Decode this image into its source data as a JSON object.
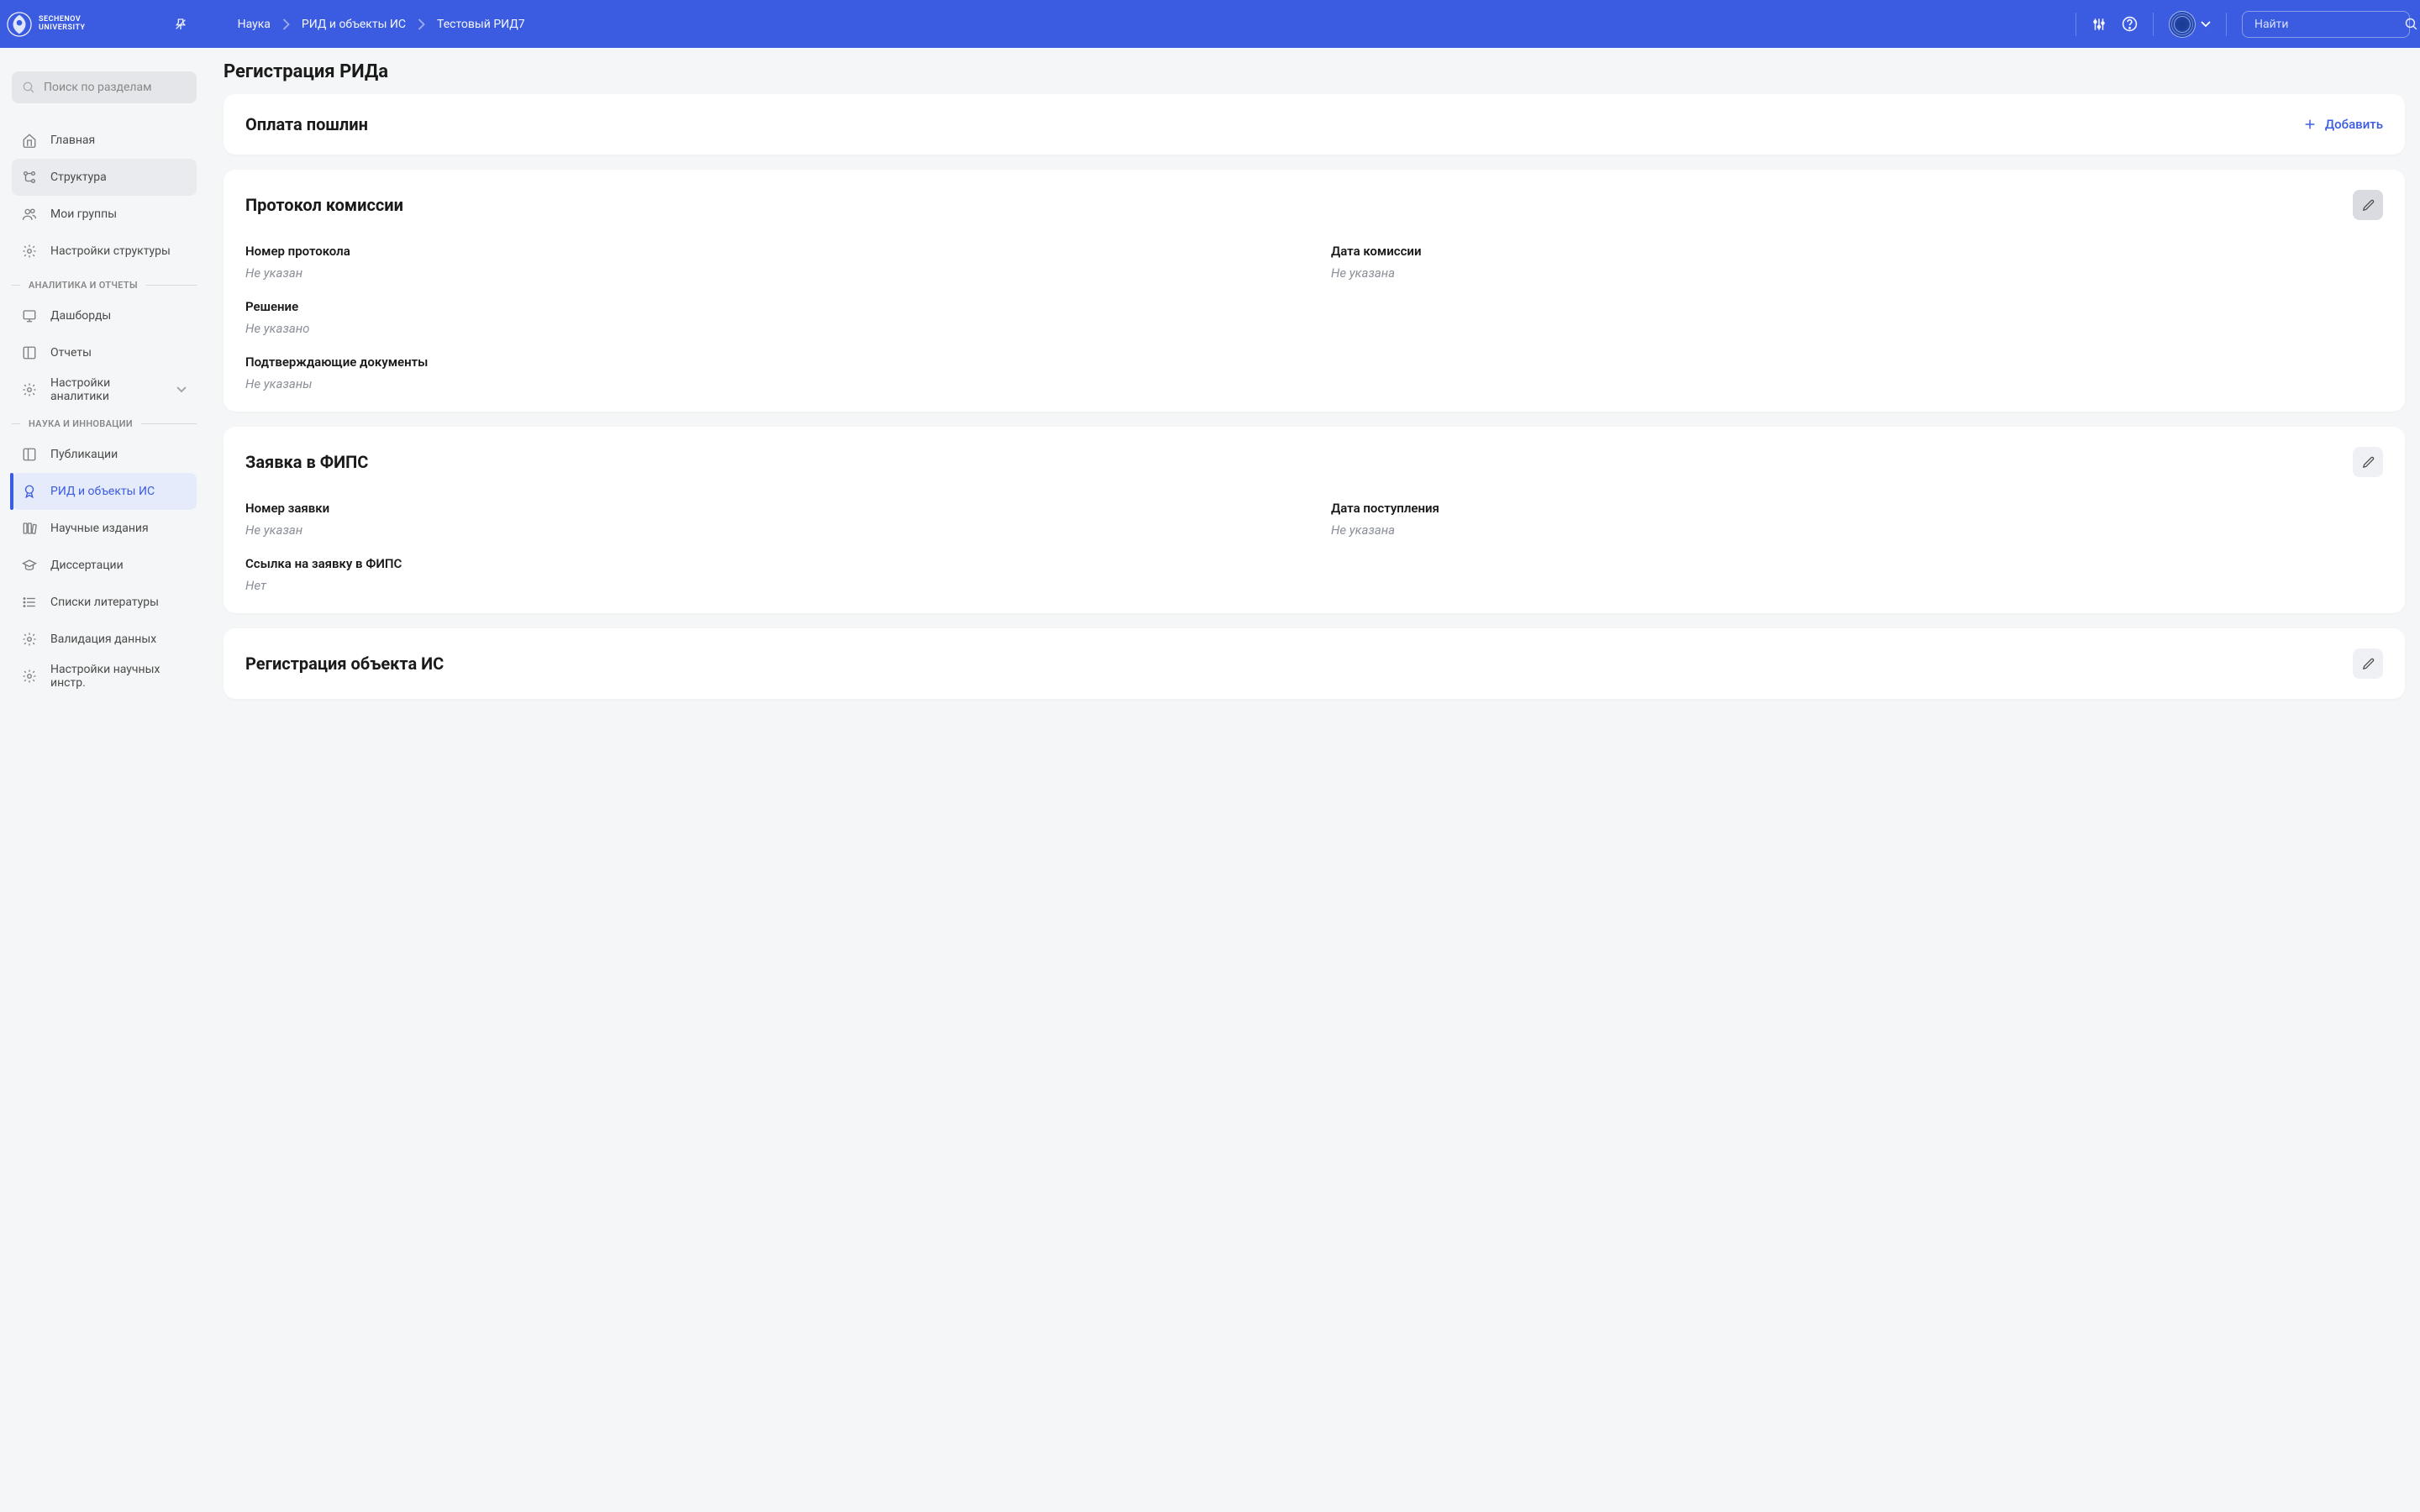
{
  "header": {
    "logo_line1": "SECHENOV",
    "logo_line2": "UNIVERSITY",
    "breadcrumb": [
      "Наука",
      "РИД и объекты ИС",
      "Тестовый РИД7"
    ],
    "search_placeholder": "Найти"
  },
  "sidebar": {
    "search_placeholder": "Поиск по разделам",
    "top_items": [
      {
        "label": "Главная",
        "icon": "home"
      },
      {
        "label": "Структура",
        "icon": "tree"
      },
      {
        "label": "Мои группы",
        "icon": "users"
      },
      {
        "label": "Настройки структуры",
        "icon": "gear"
      }
    ],
    "section_analytics": "АНАЛИТИКА И ОТЧЕТЫ",
    "analytics_items": [
      {
        "label": "Дашборды",
        "icon": "board"
      },
      {
        "label": "Отчеты",
        "icon": "book"
      },
      {
        "label": "Настройки аналитики",
        "icon": "gear",
        "expandable": true
      }
    ],
    "section_science": "НАУКА И ИННОВАЦИИ",
    "science_items": [
      {
        "label": "Публикации",
        "icon": "book"
      },
      {
        "label": "РИД и объекты ИС",
        "icon": "badge",
        "active": true
      },
      {
        "label": "Научные издания",
        "icon": "books"
      },
      {
        "label": "Диссертации",
        "icon": "cap"
      },
      {
        "label": "Списки литературы",
        "icon": "list"
      },
      {
        "label": "Валидация данных",
        "icon": "gear"
      },
      {
        "label": "Настройки научных инстр.",
        "icon": "gear"
      }
    ]
  },
  "page": {
    "title": "Регистрация РИДа",
    "card_fees": {
      "title": "Оплата пошлин",
      "add_label": "Добавить"
    },
    "card_protocol": {
      "title": "Протокол комиссии",
      "f1_label": "Номер протокола",
      "f1_value": "Не указан",
      "f2_label": "Дата комиссии",
      "f2_value": "Не указана",
      "f3_label": "Решение",
      "f3_value": "Не указано",
      "f4_label": "Подтверждающие документы",
      "f4_value": "Не указаны"
    },
    "card_fips": {
      "title": "Заявка в ФИПС",
      "f1_label": "Номер заявки",
      "f1_value": "Не указан",
      "f2_label": "Дата поступления",
      "f2_value": "Не указана",
      "f3_label": "Ссылка на заявку в ФИПС",
      "f3_value": "Нет"
    },
    "card_reg": {
      "title": "Регистрация объекта ИС"
    }
  }
}
